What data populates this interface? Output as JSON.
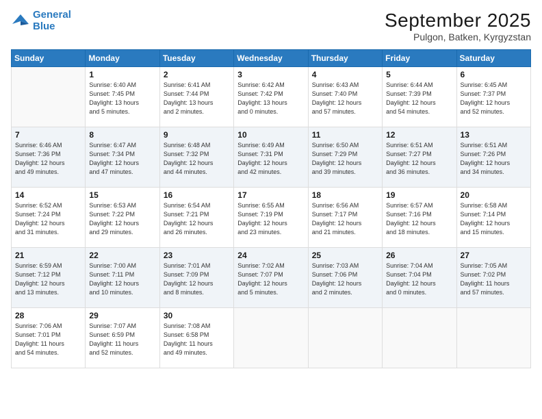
{
  "logo": {
    "line1": "General",
    "line2": "Blue"
  },
  "title": "September 2025",
  "location": "Pulgon, Batken, Kyrgyzstan",
  "weekdays": [
    "Sunday",
    "Monday",
    "Tuesday",
    "Wednesday",
    "Thursday",
    "Friday",
    "Saturday"
  ],
  "weeks": [
    [
      {
        "day": "",
        "info": ""
      },
      {
        "day": "1",
        "info": "Sunrise: 6:40 AM\nSunset: 7:45 PM\nDaylight: 13 hours\nand 5 minutes."
      },
      {
        "day": "2",
        "info": "Sunrise: 6:41 AM\nSunset: 7:44 PM\nDaylight: 13 hours\nand 2 minutes."
      },
      {
        "day": "3",
        "info": "Sunrise: 6:42 AM\nSunset: 7:42 PM\nDaylight: 13 hours\nand 0 minutes."
      },
      {
        "day": "4",
        "info": "Sunrise: 6:43 AM\nSunset: 7:40 PM\nDaylight: 12 hours\nand 57 minutes."
      },
      {
        "day": "5",
        "info": "Sunrise: 6:44 AM\nSunset: 7:39 PM\nDaylight: 12 hours\nand 54 minutes."
      },
      {
        "day": "6",
        "info": "Sunrise: 6:45 AM\nSunset: 7:37 PM\nDaylight: 12 hours\nand 52 minutes."
      }
    ],
    [
      {
        "day": "7",
        "info": "Sunrise: 6:46 AM\nSunset: 7:36 PM\nDaylight: 12 hours\nand 49 minutes."
      },
      {
        "day": "8",
        "info": "Sunrise: 6:47 AM\nSunset: 7:34 PM\nDaylight: 12 hours\nand 47 minutes."
      },
      {
        "day": "9",
        "info": "Sunrise: 6:48 AM\nSunset: 7:32 PM\nDaylight: 12 hours\nand 44 minutes."
      },
      {
        "day": "10",
        "info": "Sunrise: 6:49 AM\nSunset: 7:31 PM\nDaylight: 12 hours\nand 42 minutes."
      },
      {
        "day": "11",
        "info": "Sunrise: 6:50 AM\nSunset: 7:29 PM\nDaylight: 12 hours\nand 39 minutes."
      },
      {
        "day": "12",
        "info": "Sunrise: 6:51 AM\nSunset: 7:27 PM\nDaylight: 12 hours\nand 36 minutes."
      },
      {
        "day": "13",
        "info": "Sunrise: 6:51 AM\nSunset: 7:26 PM\nDaylight: 12 hours\nand 34 minutes."
      }
    ],
    [
      {
        "day": "14",
        "info": "Sunrise: 6:52 AM\nSunset: 7:24 PM\nDaylight: 12 hours\nand 31 minutes."
      },
      {
        "day": "15",
        "info": "Sunrise: 6:53 AM\nSunset: 7:22 PM\nDaylight: 12 hours\nand 29 minutes."
      },
      {
        "day": "16",
        "info": "Sunrise: 6:54 AM\nSunset: 7:21 PM\nDaylight: 12 hours\nand 26 minutes."
      },
      {
        "day": "17",
        "info": "Sunrise: 6:55 AM\nSunset: 7:19 PM\nDaylight: 12 hours\nand 23 minutes."
      },
      {
        "day": "18",
        "info": "Sunrise: 6:56 AM\nSunset: 7:17 PM\nDaylight: 12 hours\nand 21 minutes."
      },
      {
        "day": "19",
        "info": "Sunrise: 6:57 AM\nSunset: 7:16 PM\nDaylight: 12 hours\nand 18 minutes."
      },
      {
        "day": "20",
        "info": "Sunrise: 6:58 AM\nSunset: 7:14 PM\nDaylight: 12 hours\nand 15 minutes."
      }
    ],
    [
      {
        "day": "21",
        "info": "Sunrise: 6:59 AM\nSunset: 7:12 PM\nDaylight: 12 hours\nand 13 minutes."
      },
      {
        "day": "22",
        "info": "Sunrise: 7:00 AM\nSunset: 7:11 PM\nDaylight: 12 hours\nand 10 minutes."
      },
      {
        "day": "23",
        "info": "Sunrise: 7:01 AM\nSunset: 7:09 PM\nDaylight: 12 hours\nand 8 minutes."
      },
      {
        "day": "24",
        "info": "Sunrise: 7:02 AM\nSunset: 7:07 PM\nDaylight: 12 hours\nand 5 minutes."
      },
      {
        "day": "25",
        "info": "Sunrise: 7:03 AM\nSunset: 7:06 PM\nDaylight: 12 hours\nand 2 minutes."
      },
      {
        "day": "26",
        "info": "Sunrise: 7:04 AM\nSunset: 7:04 PM\nDaylight: 12 hours\nand 0 minutes."
      },
      {
        "day": "27",
        "info": "Sunrise: 7:05 AM\nSunset: 7:02 PM\nDaylight: 11 hours\nand 57 minutes."
      }
    ],
    [
      {
        "day": "28",
        "info": "Sunrise: 7:06 AM\nSunset: 7:01 PM\nDaylight: 11 hours\nand 54 minutes."
      },
      {
        "day": "29",
        "info": "Sunrise: 7:07 AM\nSunset: 6:59 PM\nDaylight: 11 hours\nand 52 minutes."
      },
      {
        "day": "30",
        "info": "Sunrise: 7:08 AM\nSunset: 6:58 PM\nDaylight: 11 hours\nand 49 minutes."
      },
      {
        "day": "",
        "info": ""
      },
      {
        "day": "",
        "info": ""
      },
      {
        "day": "",
        "info": ""
      },
      {
        "day": "",
        "info": ""
      }
    ]
  ]
}
